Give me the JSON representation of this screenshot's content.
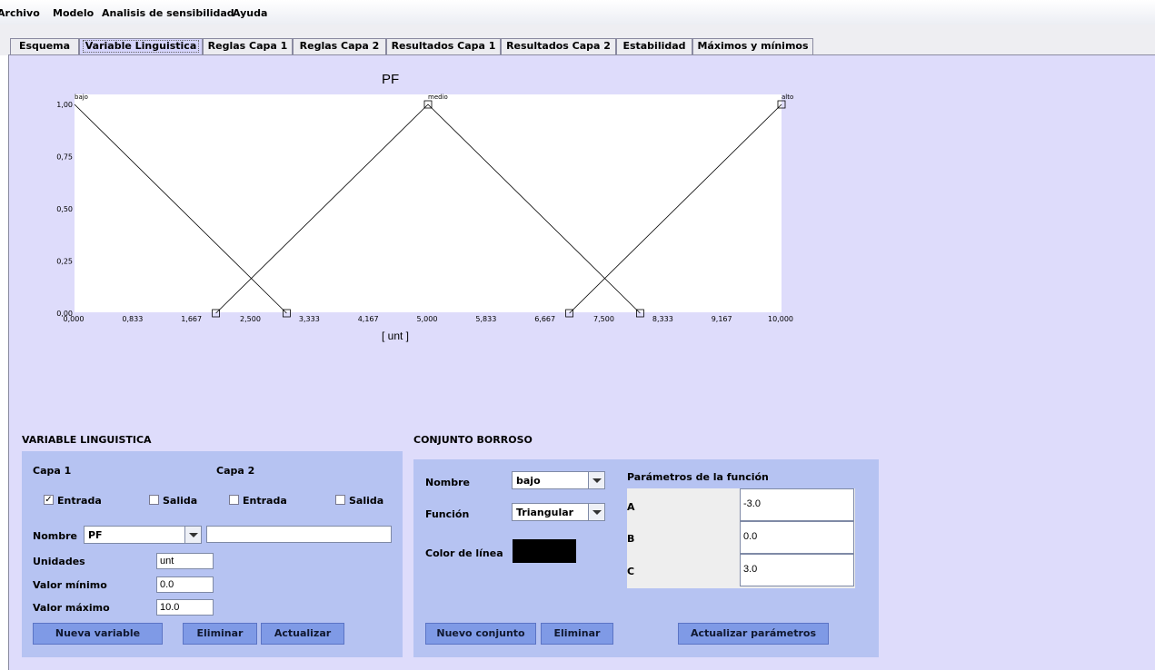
{
  "menu": [
    "Archivo",
    "Modelo",
    "Analisis de sensibilidad",
    "Ayuda"
  ],
  "tabs": [
    "Esquema",
    "Variable Linguistica",
    "Reglas Capa 1",
    "Reglas Capa 2",
    "Resultados Capa 1",
    "Resultados Capa 2",
    "Estabilidad",
    "Máximos y mínimos"
  ],
  "active_tab": "Variable Linguistica",
  "chart_data": {
    "type": "line",
    "title": "PF",
    "xlabel": "[ unt ]",
    "ylabel": "",
    "xlim": [
      0,
      10
    ],
    "ylim": [
      0,
      1
    ],
    "x_ticks": [
      "0,000",
      "0,833",
      "1,667",
      "2,500",
      "3,333",
      "4,167",
      "5,000",
      "5,833",
      "6,667",
      "7,500",
      "8,333",
      "9,167",
      "10,000"
    ],
    "y_ticks": [
      "0,00",
      "0,25",
      "0,50",
      "0,75",
      "1,00"
    ],
    "series": [
      {
        "name": "bajo",
        "x": [
          0,
          3
        ],
        "y": [
          1,
          0
        ],
        "color": "#000000"
      },
      {
        "name": "medio",
        "x": [
          2,
          5,
          8
        ],
        "y": [
          0,
          1,
          0
        ],
        "color": "#000000"
      },
      {
        "name": "alto",
        "x": [
          7,
          10
        ],
        "y": [
          0,
          1
        ],
        "color": "#000000"
      }
    ]
  },
  "variable": {
    "section_title": "VARIABLE LINGUISTICA",
    "capa1_label": "Capa 1",
    "capa2_label": "Capa 2",
    "capa1_entrada": {
      "label": "Entrada",
      "checked": true
    },
    "capa1_salida": {
      "label": "Salida",
      "checked": false
    },
    "capa2_entrada": {
      "label": "Entrada",
      "checked": false
    },
    "capa2_salida": {
      "label": "Salida",
      "checked": false
    },
    "nombre_label": "Nombre",
    "nombre_value": "PF",
    "nombre_text": "",
    "unidades_label": "Unidades",
    "unidades_value": "unt",
    "min_label": "Valor mínimo",
    "min_value": "0.0",
    "max_label": "Valor máximo",
    "max_value": "10.0",
    "btn_nueva": "Nueva variable",
    "btn_eliminar": "Eliminar",
    "btn_actualizar": "Actualizar"
  },
  "conjunto": {
    "section_title": "CONJUNTO BORROSO",
    "nombre_label": "Nombre",
    "nombre_value": "bajo",
    "funcion_label": "Función",
    "funcion_value": "Triangular",
    "color_label": "Color de línea",
    "color_value": "#000000",
    "params_title": "Parámetros de la función",
    "params": [
      {
        "name": "A",
        "value": "-3.0"
      },
      {
        "name": "B",
        "value": "0.0"
      },
      {
        "name": "C",
        "value": "3.0"
      }
    ],
    "btn_nuevo": "Nuevo conjunto",
    "btn_eliminar": "Eliminar",
    "btn_actualizar": "Actualizar parámetros"
  }
}
